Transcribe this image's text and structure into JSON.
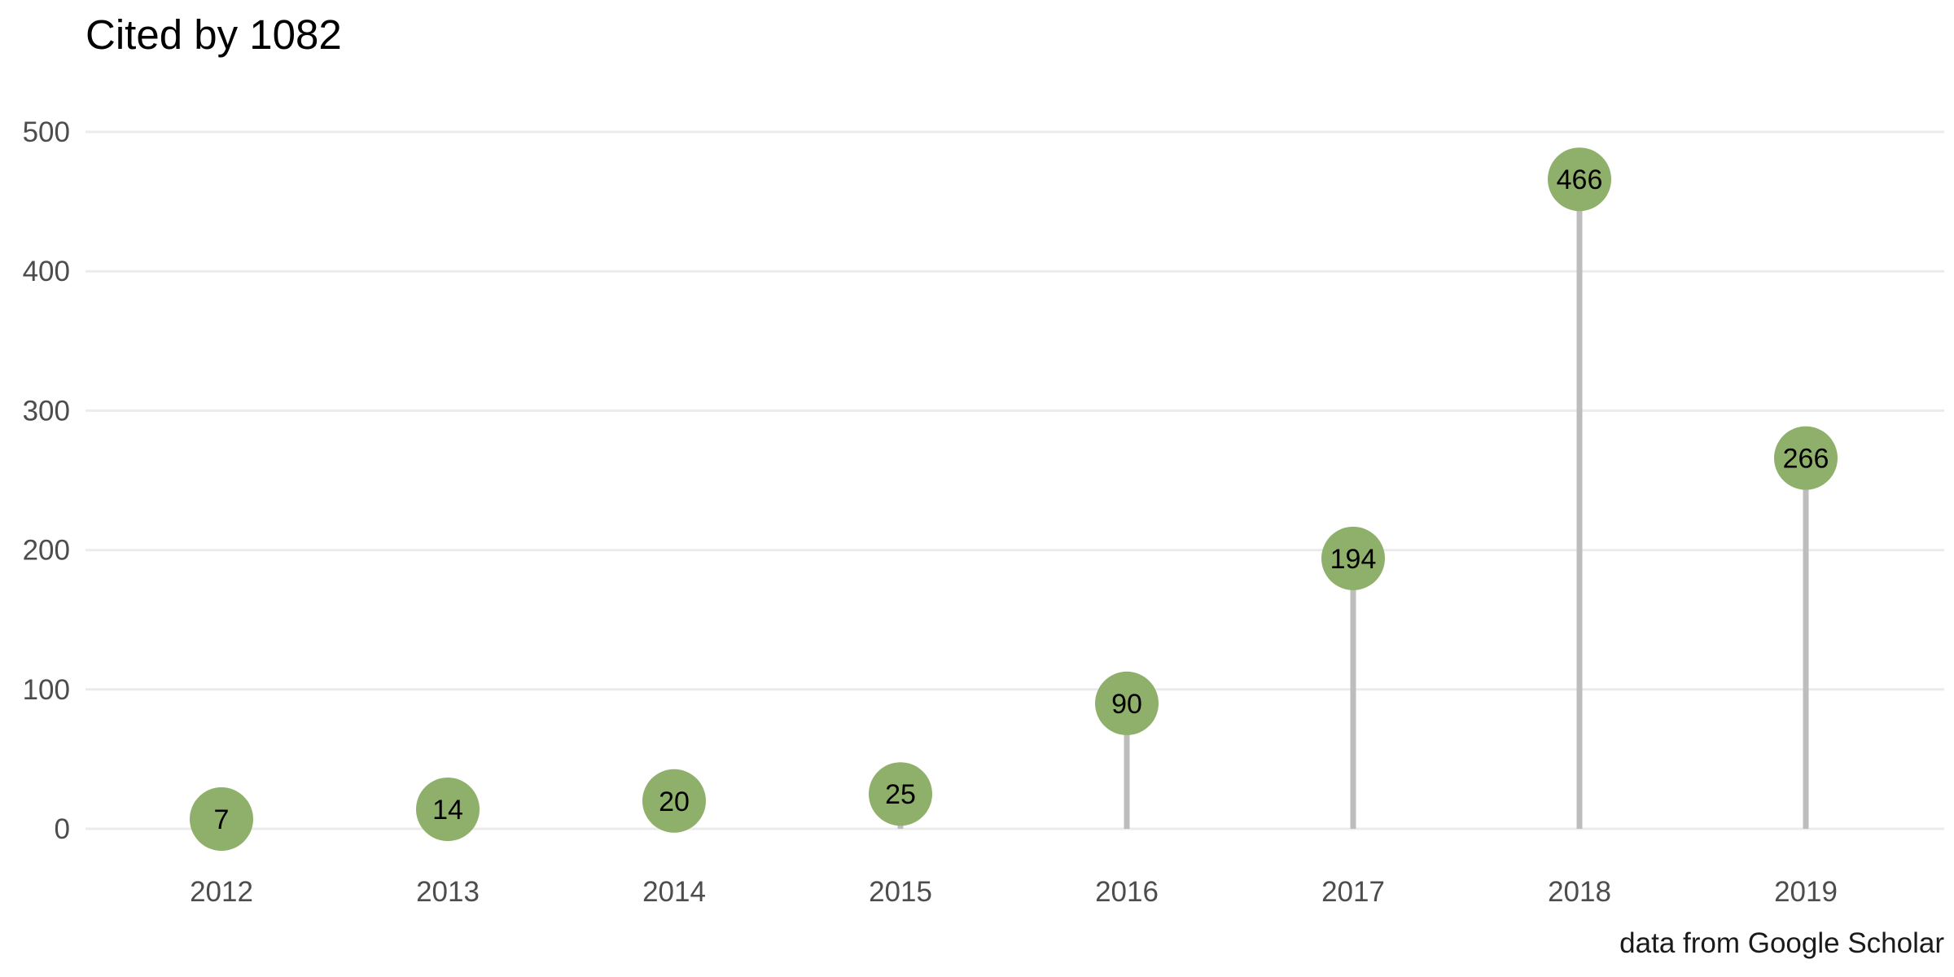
{
  "chart_data": {
    "type": "lollipop",
    "title": "Cited by 1082",
    "caption": "data from Google Scholar",
    "xlabel": "",
    "ylabel": "",
    "categories": [
      "2012",
      "2013",
      "2014",
      "2015",
      "2016",
      "2017",
      "2018",
      "2019"
    ],
    "values": [
      7,
      14,
      20,
      25,
      90,
      194,
      466,
      266
    ],
    "data_labels": [
      "7",
      "14",
      "20",
      "25",
      "90",
      "194",
      "466",
      "266"
    ],
    "yticks": [
      "0",
      "100",
      "200",
      "300",
      "400",
      "500"
    ],
    "ylim": [
      0,
      500
    ],
    "grid": true,
    "legend": "none",
    "colors": {
      "point": "#8fb06a",
      "stem": "#bdbdbd",
      "grid": "#ebebeb",
      "tick_text": "#4d4d4d",
      "title_text": "#000000"
    }
  }
}
